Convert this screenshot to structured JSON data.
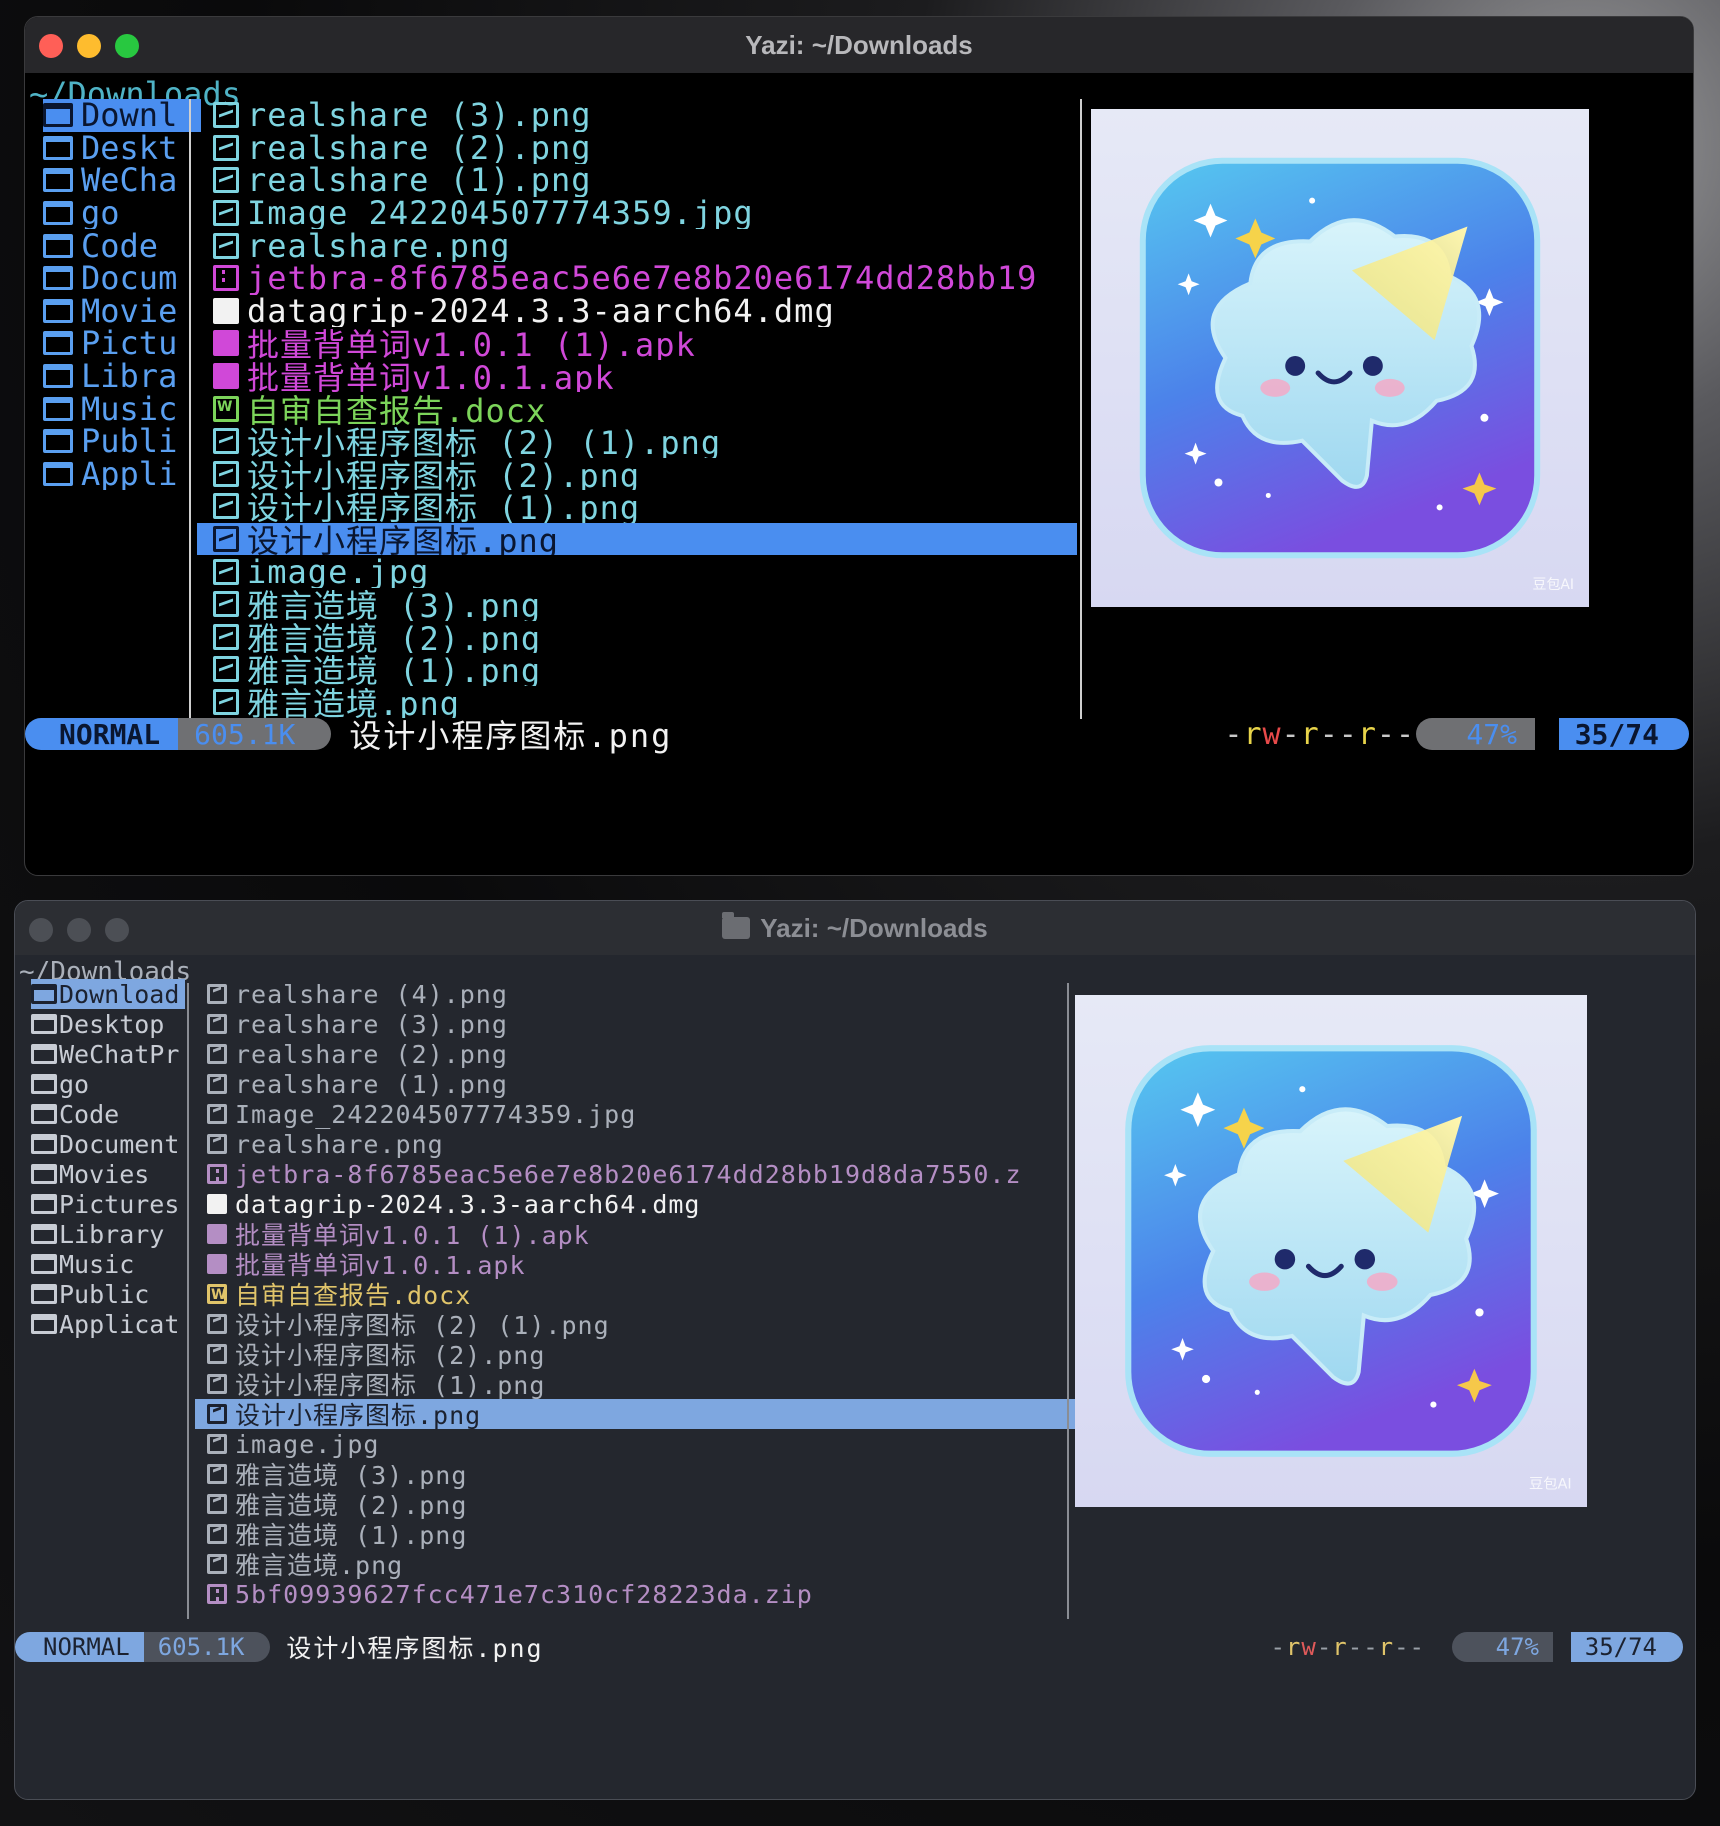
{
  "window1": {
    "title": "Yazi: ~/Downloads",
    "path": "~/Downloads",
    "parent_dirs": [
      "Downl",
      "Deskt",
      "WeCha",
      "go",
      "Code",
      "Docum",
      "Movie",
      "Pictu",
      "Libra",
      "Music",
      "Publi",
      "Appli"
    ],
    "files": [
      {
        "name": "realshare (3).png",
        "kind": "image"
      },
      {
        "name": "realshare (2).png",
        "kind": "image"
      },
      {
        "name": "realshare (1).png",
        "kind": "image"
      },
      {
        "name": "Image_242204507774359.jpg",
        "kind": "image"
      },
      {
        "name": "realshare.png",
        "kind": "image"
      },
      {
        "name": "jetbra-8f6785eac5e6e7e8b20e6174dd28bb19",
        "kind": "zip"
      },
      {
        "name": "datagrip-2024.3.3-aarch64.dmg",
        "kind": "dmg"
      },
      {
        "name": "批量背单词v1.0.1 (1).apk",
        "kind": "apk"
      },
      {
        "name": "批量背单词v1.0.1.apk",
        "kind": "apk"
      },
      {
        "name": "自审自查报告.docx",
        "kind": "docx"
      },
      {
        "name": "设计小程序图标 (2) (1).png",
        "kind": "image"
      },
      {
        "name": "设计小程序图标 (2).png",
        "kind": "image"
      },
      {
        "name": "设计小程序图标 (1).png",
        "kind": "image"
      },
      {
        "name": "设计小程序图标.png",
        "kind": "image",
        "selected": true
      },
      {
        "name": "image.jpg",
        "kind": "image"
      },
      {
        "name": "雅言造境 (3).png",
        "kind": "image"
      },
      {
        "name": "雅言造境 (2).png",
        "kind": "image"
      },
      {
        "name": "雅言造境 (1).png",
        "kind": "image"
      },
      {
        "name": "雅言造境.png",
        "kind": "image"
      }
    ],
    "status": {
      "mode": "NORMAL",
      "size": "605.1K",
      "selected": "设计小程序图标.png",
      "perm": "-rw-r--r--",
      "percent": "47%",
      "position": "35/74"
    }
  },
  "window2": {
    "title": "Yazi: ~/Downloads",
    "path": "~/Downloads",
    "parent_dirs": [
      "Download",
      "Desktop",
      "WeChatPr",
      "go",
      "Code",
      "Document",
      "Movies",
      "Pictures",
      "Library",
      "Music",
      "Public",
      "Applicat"
    ],
    "files": [
      {
        "name": "realshare (4).png",
        "kind": "image"
      },
      {
        "name": "realshare (3).png",
        "kind": "image"
      },
      {
        "name": "realshare (2).png",
        "kind": "image"
      },
      {
        "name": "realshare (1).png",
        "kind": "image"
      },
      {
        "name": "Image_242204507774359.jpg",
        "kind": "image"
      },
      {
        "name": "realshare.png",
        "kind": "image"
      },
      {
        "name": "jetbra-8f6785eac5e6e7e8b20e6174dd28bb19d8da7550.z",
        "kind": "zip"
      },
      {
        "name": "datagrip-2024.3.3-aarch64.dmg",
        "kind": "dmg"
      },
      {
        "name": "批量背单词v1.0.1 (1).apk",
        "kind": "apk"
      },
      {
        "name": "批量背单词v1.0.1.apk",
        "kind": "apk"
      },
      {
        "name": "自审自查报告.docx",
        "kind": "docx"
      },
      {
        "name": "设计小程序图标 (2) (1).png",
        "kind": "image"
      },
      {
        "name": "设计小程序图标 (2).png",
        "kind": "image"
      },
      {
        "name": "设计小程序图标 (1).png",
        "kind": "image"
      },
      {
        "name": "设计小程序图标.png",
        "kind": "image",
        "selected": true
      },
      {
        "name": "image.jpg",
        "kind": "image"
      },
      {
        "name": "雅言造境 (3).png",
        "kind": "image"
      },
      {
        "name": "雅言造境 (2).png",
        "kind": "image"
      },
      {
        "name": "雅言造境 (1).png",
        "kind": "image"
      },
      {
        "name": "雅言造境.png",
        "kind": "image"
      },
      {
        "name": "5bf09939627fcc471e7c310cf28223da.zip",
        "kind": "zip"
      }
    ],
    "status": {
      "mode": "NORMAL",
      "size": "605.1K",
      "selected": "设计小程序图标.png",
      "perm": "-rw-r--r--",
      "percent": "47%",
      "position": "35/74"
    }
  },
  "preview_watermark": "豆包AI",
  "colors": {
    "accent_dark_theme": "#4a8ef0",
    "accent_light_theme": "#7ea7e0",
    "traffic_red": "#ff5f57",
    "traffic_yellow": "#febc2e",
    "traffic_green": "#28c840"
  }
}
